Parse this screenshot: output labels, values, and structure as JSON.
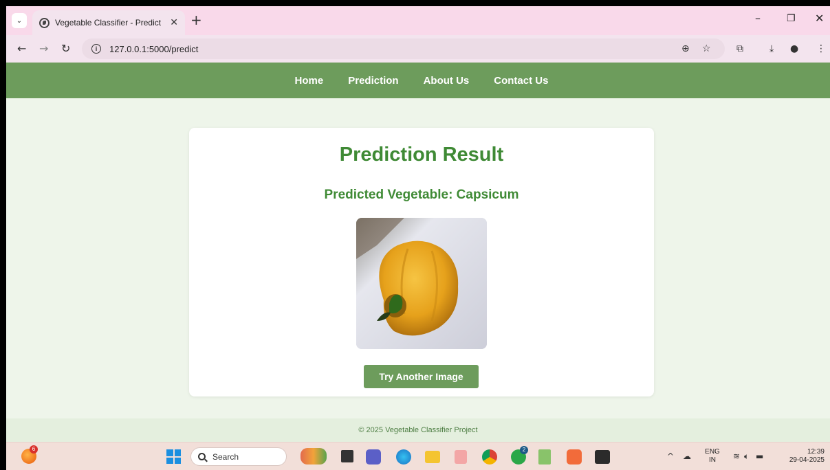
{
  "browser": {
    "tab_title": "Vegetable Classifier - Predict",
    "tab_close": "✕",
    "new_tab": "+",
    "url": "127.0.0.1:5000/predict",
    "controls": {
      "minimize": "–",
      "restore": "❐",
      "close": "✕"
    }
  },
  "nav": {
    "items": [
      {
        "label": "Home"
      },
      {
        "label": "Prediction"
      },
      {
        "label": "About Us"
      },
      {
        "label": "Contact Us"
      }
    ]
  },
  "result": {
    "title": "Prediction Result",
    "predicted_text": "Predicted Vegetable: Capsicum",
    "button_label": "Try Another Image"
  },
  "footer": {
    "text": "© 2025 Vegetable Classifier Project"
  },
  "taskbar": {
    "search_label": "Search",
    "notification_count": "6",
    "whatsapp_badge": "2",
    "language_line1": "ENG",
    "language_line2": "IN",
    "time": "12:39",
    "date": "29-04-2025"
  },
  "colors": {
    "accent_green": "#6d9c5c",
    "title_green": "#3f8a35",
    "page_bg": "#eef5ea",
    "tab_bg": "#f9d9ea"
  }
}
